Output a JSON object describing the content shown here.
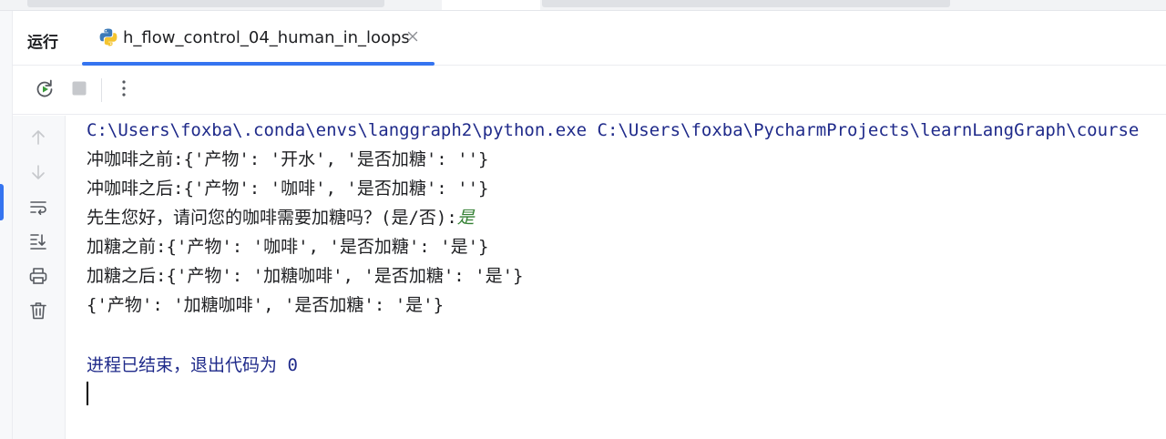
{
  "run_panel": {
    "title": "运行",
    "tab": {
      "label": "h_flow_control_04_human_in_loops",
      "icon": "python-icon"
    }
  },
  "toolbar": {
    "buttons": [
      "rerun-icon",
      "stop-icon",
      "more-icon"
    ]
  },
  "gutter": {
    "buttons": [
      "arrow-up-icon",
      "arrow-down-icon",
      "soft-wrap-icon",
      "scroll-to-end-icon",
      "print-icon",
      "trash-icon"
    ]
  },
  "console": {
    "command_line": "C:\\Users\\foxba\\.conda\\envs\\langgraph2\\python.exe C:\\Users\\foxba\\PycharmProjects\\learnLangGraph\\course",
    "lines": [
      "冲咖啡之前:{'产物': '开水', '是否加糖': ''}",
      "冲咖啡之后:{'产物': '咖啡', '是否加糖': ''}",
      "先生您好，请问您的咖啡需要加糖吗？(是/否):",
      "加糖之前:{'产物': '咖啡', '是否加糖': '是'}",
      "加糖之后:{'产物': '加糖咖啡', '是否加糖': '是'}",
      "{'产物': '加糖咖啡', '是否加糖': '是'}"
    ],
    "user_input": "是",
    "exit_message": "进程已结束，退出代码为 0"
  },
  "colors": {
    "accent": "#3574f0",
    "command_text": "#1f2a8a",
    "user_input_text": "#338033"
  }
}
